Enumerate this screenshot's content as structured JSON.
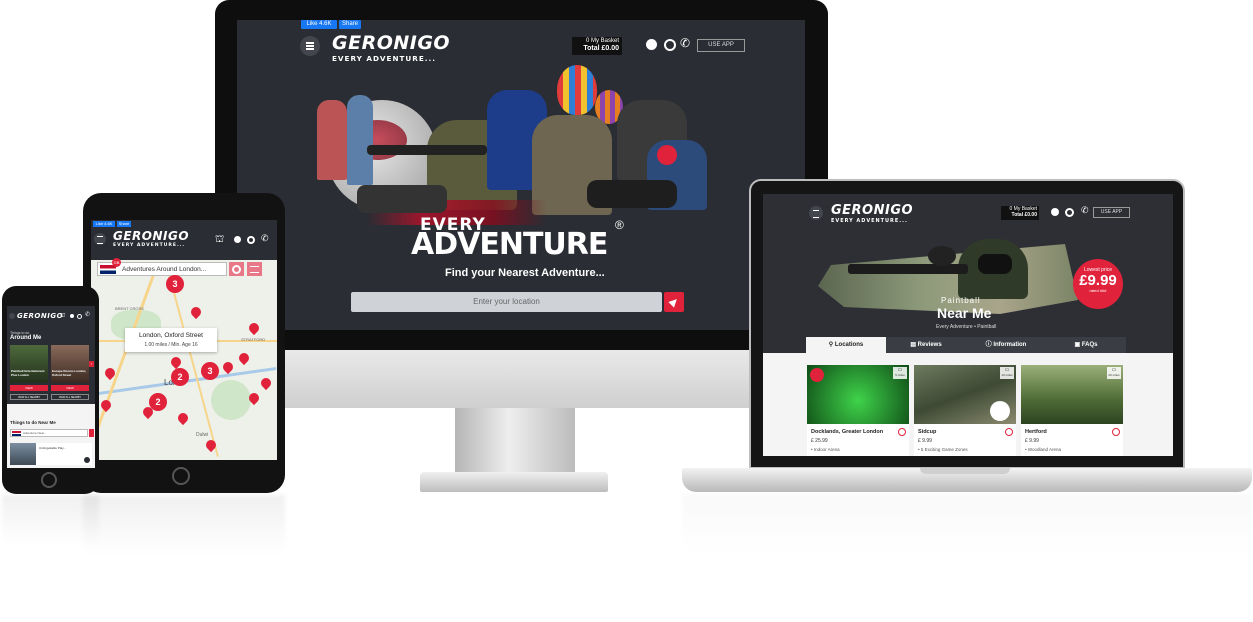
{
  "colors": {
    "accent": "#e0223b",
    "dark": "#2a2d33",
    "map_green": "#cfe6c8"
  },
  "desktop": {
    "fb_like": "Like 4.6K",
    "fb_share": "Share",
    "logo": "GERONIGO",
    "logo_tag": "EVERY ADVENTURE...",
    "basket_label": "0 My Basket",
    "basket_total": "Total £0.00",
    "use_app": "USE APP",
    "hero_line1": "EVERY",
    "hero_line2": "ADVENTURE",
    "registered": "®",
    "subtitle": "Find your Nearest Adventure...",
    "search_placeholder": "Enter your location"
  },
  "laptop": {
    "logo": "GERONIGO",
    "logo_tag": "EVERY ADVENTURE...",
    "basket_label": "0 My Basket",
    "basket_total": "Total £0.00",
    "use_app": "USE APP",
    "badge_top": "Lowest price",
    "badge_price": "£9.99",
    "badge_bottom": "rated ###",
    "category": "Paintball",
    "title": "Near Me",
    "breadcrumb_1": "Every Adventure",
    "breadcrumb_2": "Paintball",
    "tabs": [
      {
        "label": "Locations"
      },
      {
        "label": "Reviews"
      },
      {
        "label": "Information"
      },
      {
        "label": "FAQs"
      }
    ],
    "cards": [
      {
        "title": "Docklands, Greater London",
        "price": "£ 25.99",
        "feature": "Indoor Arena",
        "distance": "5 miles"
      },
      {
        "title": "Sidcup",
        "price": "£ 9.99",
        "feature": "5 Exciting Game Zones",
        "distance": "10 miles"
      },
      {
        "title": "Hertford",
        "price": "£ 9.99",
        "feature": "Woodland Arena",
        "distance": "20 miles"
      }
    ]
  },
  "tablet": {
    "fb_like": "Like 4.6K",
    "fb_share": "Share",
    "logo": "GERONIGO",
    "logo_tag": "EVERY ADVENTURE...",
    "flag_badge": "GB",
    "search_value": "Adventures Around London...",
    "popup_title": "London, Oxford Street",
    "popup_sub": "1.00 miles / Min. Age 16",
    "map_labels": [
      "BRENT CROSS",
      "STRATFORD",
      "Lon",
      "Dulwi"
    ],
    "clusters": [
      "3",
      "2",
      "2",
      "3"
    ]
  },
  "phone": {
    "logo": "GERONIGO",
    "section_small": "Things to do",
    "section_title": "Around Me",
    "card1_title": "Paintball Entertainment Plus London",
    "card2_title": "Escape Rooms London, Oxford Street",
    "view1": "VIEW",
    "view2": "VIEW",
    "all1": "VIEW ALL NEARBY",
    "all2": "VIEW ALL NEARBY",
    "near_title": "Things to do Near Me",
    "near_placeholder": "Adventure Near...",
    "list_item": "Unforgettable Play..."
  }
}
